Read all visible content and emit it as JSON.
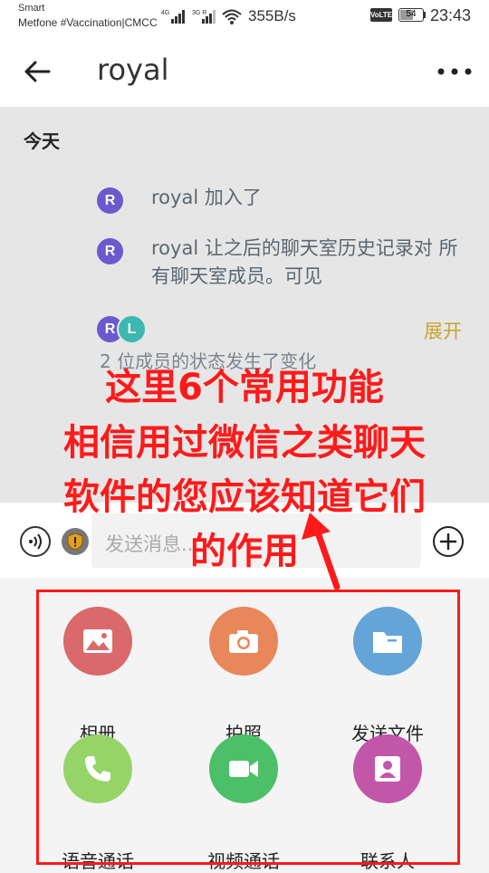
{
  "status_bar": {
    "carrier_line1": "Smart",
    "carrier_line2": "Metfone #Vaccination|CMCC",
    "signal1": "4G",
    "signal2": "3G R",
    "speed": "355B/s",
    "volte": "VoLTE",
    "battery": "54",
    "time": "23:43"
  },
  "header": {
    "title": "royal",
    "back_icon": "arrow-left-icon",
    "more_icon": "more-horizontal-icon"
  },
  "chat": {
    "date_label": "今天",
    "events": [
      {
        "avatar": "R",
        "text": "royal 加入了"
      },
      {
        "avatar": "R",
        "text": "royal 让之后的聊天室历史记录对 所有聊天室成员。可见"
      }
    ],
    "group_event": {
      "avatars": [
        "R",
        "L"
      ],
      "expand_label": "展开",
      "partial_text": "2 位成员的状态发生了变化"
    }
  },
  "input_bar": {
    "placeholder": "发送消息...",
    "voice_icon": "voice-icon",
    "shield_icon": "shield-icon",
    "plus_icon": "plus-circle-icon"
  },
  "actions": [
    {
      "label": "相册",
      "icon": "image-icon",
      "color": "#d9696b"
    },
    {
      "label": "拍照",
      "icon": "camera-icon",
      "color": "#e8875a"
    },
    {
      "label": "发送文件",
      "icon": "folder-icon",
      "color": "#65a4d6"
    },
    {
      "label": "语音通话",
      "icon": "phone-icon",
      "color": "#96d468"
    },
    {
      "label": "视频通话",
      "icon": "video-icon",
      "color": "#4cc069"
    },
    {
      "label": "联系人",
      "icon": "contact-icon",
      "color": "#c256a9"
    }
  ],
  "annotation": {
    "lines": [
      "这里6个常用功能",
      "相信用过微信之类聊天",
      "软件的您应该知道它们",
      "的作用"
    ],
    "color": "#ff1a1a"
  }
}
